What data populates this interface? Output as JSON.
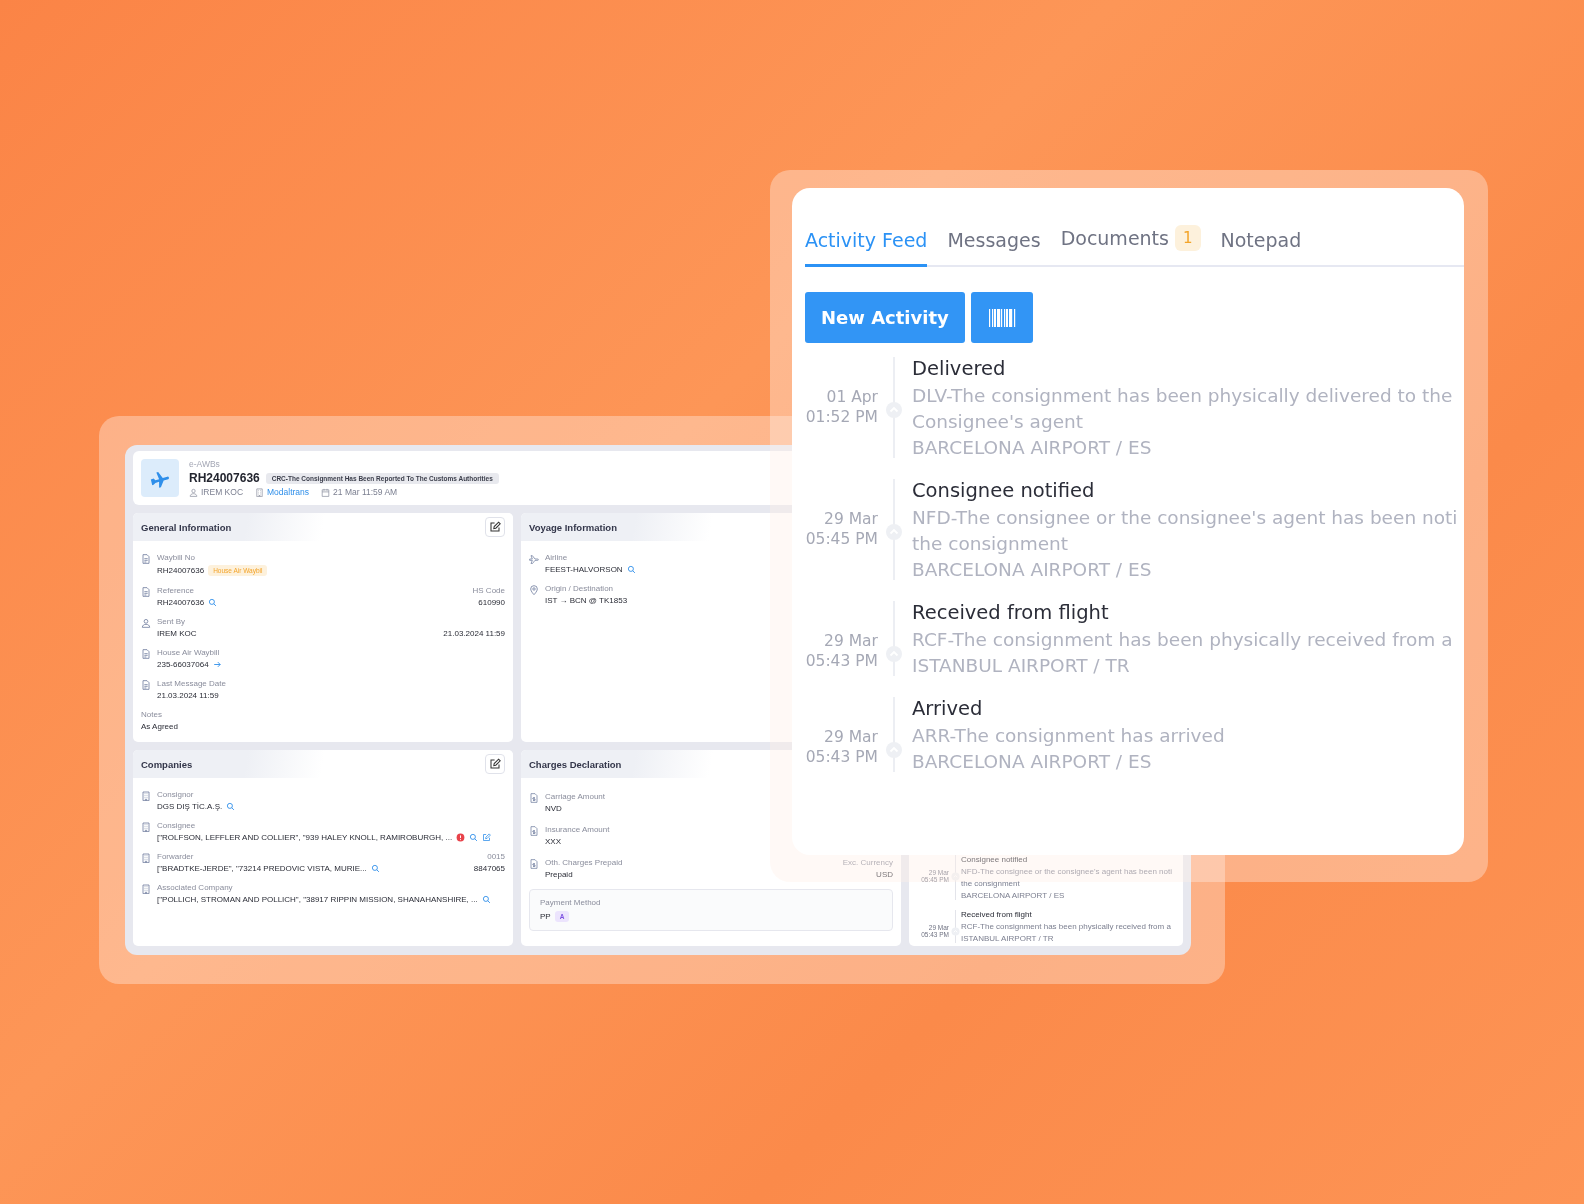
{
  "app": {
    "header": {
      "section": "e-AWBs",
      "waybill": "RH24007636",
      "status": "CRC-The Consignment Has Been Reported To The Customs Authorities",
      "meta": [
        {
          "kind": "user",
          "text": "IREM KOC",
          "link": false
        },
        {
          "kind": "building",
          "text": "Modaltrans",
          "link": true
        },
        {
          "kind": "calendar",
          "text": "21 Mar 11:59 AM",
          "link": false
        }
      ]
    },
    "cards": [
      {
        "title": "General Information",
        "editable": true,
        "fields": [
          {
            "kind": "doc",
            "label": "Waybill No",
            "value": "RH24007636",
            "tag": "House Air Waybil"
          },
          {
            "kind": "doc",
            "label": "Reference",
            "value": "RH24007636",
            "actions": [
              {
                "kind": "search"
              }
            ],
            "right_label": "HS Code",
            "right_value": "610990"
          },
          {
            "kind": "user",
            "label": "Sent By",
            "value": "IREM KOC",
            "right_value": "21.03.2024 11:59"
          },
          {
            "kind": "doc",
            "label": "House Air Waybill",
            "value": "235-66037064",
            "actions": [
              {
                "kind": "arrow"
              }
            ]
          },
          {
            "kind": "doc",
            "label": "Last Message Date",
            "value": "21.03.2024 11:59"
          },
          {
            "kind": "plain",
            "label": "Notes",
            "value": "As Agreed"
          }
        ]
      },
      {
        "title": "Voyage Information",
        "fields": [
          {
            "kind": "plane",
            "label": "Airline",
            "value": "FEEST-HALVORSON",
            "actions": [
              {
                "kind": "search"
              }
            ]
          },
          {
            "kind": "pin",
            "label": "Origin / Destination",
            "value": "IST → BCN @ TK1853"
          }
        ]
      },
      {
        "title": "Companies",
        "editable": true,
        "fields": [
          {
            "kind": "building",
            "label": "Consignor",
            "value": "DGS DIŞ TİC.A.Ş.",
            "actions": [
              {
                "kind": "search"
              }
            ]
          },
          {
            "kind": "building",
            "label": "Consignee",
            "value": "[\"ROLFSON, LEFFLER AND COLLIER\", \"939 HALEY KNOLL, RAMIROBURGH, ...",
            "actions": [
              {
                "kind": "warning"
              },
              {
                "kind": "search"
              },
              {
                "kind": "edit"
              }
            ]
          },
          {
            "kind": "building",
            "label": "Forwarder",
            "value": "[\"BRADTKE-JERDE\", \"73214 PREDOVIC VISTA, MURIE...",
            "actions": [
              {
                "kind": "search"
              }
            ],
            "right_label": "0015",
            "right_value": "8847065"
          },
          {
            "kind": "building",
            "label": "Associated Company",
            "value": "[\"POLLICH, STROMAN AND POLLICH\", \"38917 RIPPIN MISSION, SHANAHANSHIRE, ...",
            "actions": [
              {
                "kind": "search"
              }
            ]
          }
        ]
      },
      {
        "title": "Charges Declaration",
        "fields": [
          {
            "kind": "money",
            "label": "Carriage Amount",
            "value": "NVD"
          },
          {
            "kind": "money",
            "label": "Insurance Amount",
            "value": "XXX"
          },
          {
            "kind": "money",
            "label": "Oth. Charges Prepaid",
            "value": "Prepaid",
            "right_label": "Exc. Currency",
            "right_value": "USD"
          }
        ],
        "payment": {
          "label": "Payment Method",
          "value": "PP",
          "badge": "A"
        }
      }
    ],
    "feed": [
      {
        "date": "29 Mar",
        "time": "05:45 PM",
        "title": "Consignee notified",
        "lines": [
          "NFD-The consignee or the consignee's agent has been noti",
          "the consignment",
          "BARCELONA AIRPORT / ES"
        ]
      },
      {
        "date": "29 Mar",
        "time": "05:43 PM",
        "title": "Received from flight",
        "lines": [
          "RCF-The consignment has been physically received from a",
          "ISTANBUL AIRPORT / TR"
        ]
      }
    ]
  },
  "panel": {
    "tabs": [
      {
        "label": "Activity Feed",
        "selected": true
      },
      {
        "label": "Messages",
        "selected": false
      },
      {
        "label": "Documents",
        "selected": false,
        "badge": "1"
      },
      {
        "label": "Notepad",
        "selected": false
      }
    ],
    "new_button": "New Activity",
    "activities": [
      {
        "date": "01 Apr",
        "time": "01:52 PM",
        "title": "Delivered",
        "lines": [
          "DLV-The consignment has been physically delivered to the",
          "Consignee's agent",
          "BARCELONA AIRPORT / ES"
        ]
      },
      {
        "date": "29 Mar",
        "time": "05:45 PM",
        "title": "Consignee notified",
        "lines": [
          "NFD-The consignee or the consignee's agent has been noti",
          "the consignment",
          "BARCELONA AIRPORT / ES"
        ]
      },
      {
        "date": "29 Mar",
        "time": "05:43 PM",
        "title": "Received from flight",
        "lines": [
          "RCF-The consignment has been physically received from a",
          "ISTANBUL AIRPORT / TR"
        ]
      },
      {
        "date": "29 Mar",
        "time": "05:43 PM",
        "title": "Arrived",
        "lines": [
          "ARR-The consignment has arrived",
          "BARCELONA AIRPORT / ES"
        ]
      }
    ]
  }
}
